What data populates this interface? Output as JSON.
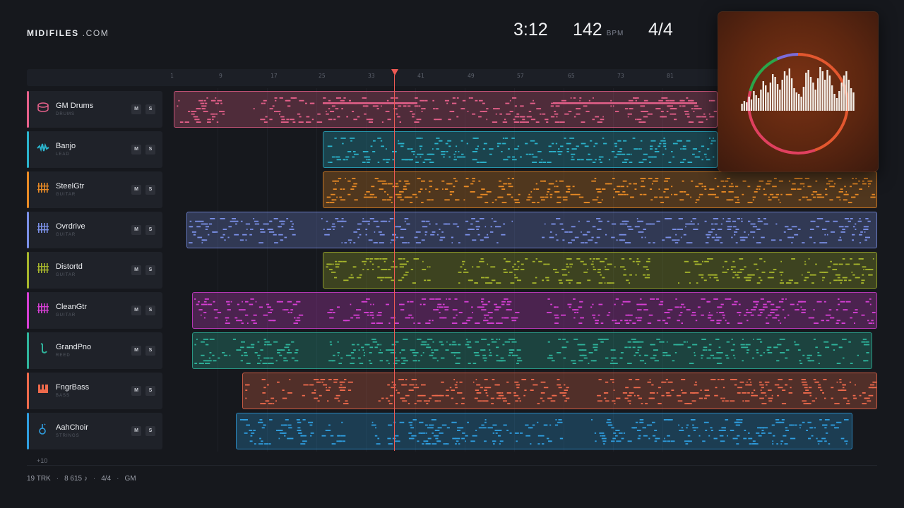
{
  "brand": {
    "main": "MIDIFILES",
    "suffix": ".COM"
  },
  "transport": {
    "time": "3:12",
    "bpm": "142",
    "bpm_unit": "BPM",
    "signature": "4/4"
  },
  "ruler": {
    "ticks": [
      "1",
      "9",
      "17",
      "25",
      "33",
      "41",
      "49",
      "57",
      "65",
      "73",
      "81"
    ]
  },
  "tracks": [
    {
      "name": "GM Drums",
      "sub": "DRUMS",
      "color": "#e5608a",
      "icon": "drum-icon",
      "mute": "M",
      "solo": "S"
    },
    {
      "name": "Banjo",
      "sub": "LEAD",
      "color": "#2bb3cc",
      "icon": "waveform-icon",
      "mute": "M",
      "solo": "S"
    },
    {
      "name": "SteelGtr",
      "sub": "GUITAR",
      "color": "#e88a25",
      "icon": "grid-icon",
      "mute": "M",
      "solo": "S"
    },
    {
      "name": "Ovrdrive",
      "sub": "GUITAR",
      "color": "#7a8fe6",
      "icon": "grid-icon",
      "mute": "M",
      "solo": "S"
    },
    {
      "name": "Distortd",
      "sub": "GUITAR",
      "color": "#a6b52c",
      "icon": "grid-icon",
      "mute": "M",
      "solo": "S"
    },
    {
      "name": "CleanGtr",
      "sub": "GUITAR",
      "color": "#d63fd4",
      "icon": "grid-icon",
      "mute": "M",
      "solo": "S"
    },
    {
      "name": "GrandPno",
      "sub": "REED",
      "color": "#2fb49c",
      "icon": "saxophone-icon",
      "mute": "M",
      "solo": "S"
    },
    {
      "name": "FngrBass",
      "sub": "BASS",
      "color": "#ee6a4c",
      "icon": "piano-icon",
      "mute": "M",
      "solo": "S"
    },
    {
      "name": "AahChoir",
      "sub": "STRINGS",
      "color": "#2f9ee0",
      "icon": "violin-icon",
      "mute": "M",
      "solo": "S"
    }
  ],
  "more_tracks": "+10",
  "footer": {
    "tracks": "19 TRK",
    "notes": "8 615 ♪",
    "signature": "4/4",
    "standard": "GM"
  },
  "visualizer": {
    "ring_colors": [
      "#e3572f",
      "#e0405f",
      "#2aa64a",
      "#7b6cd9"
    ],
    "bar_color": "#f3ede6"
  }
}
